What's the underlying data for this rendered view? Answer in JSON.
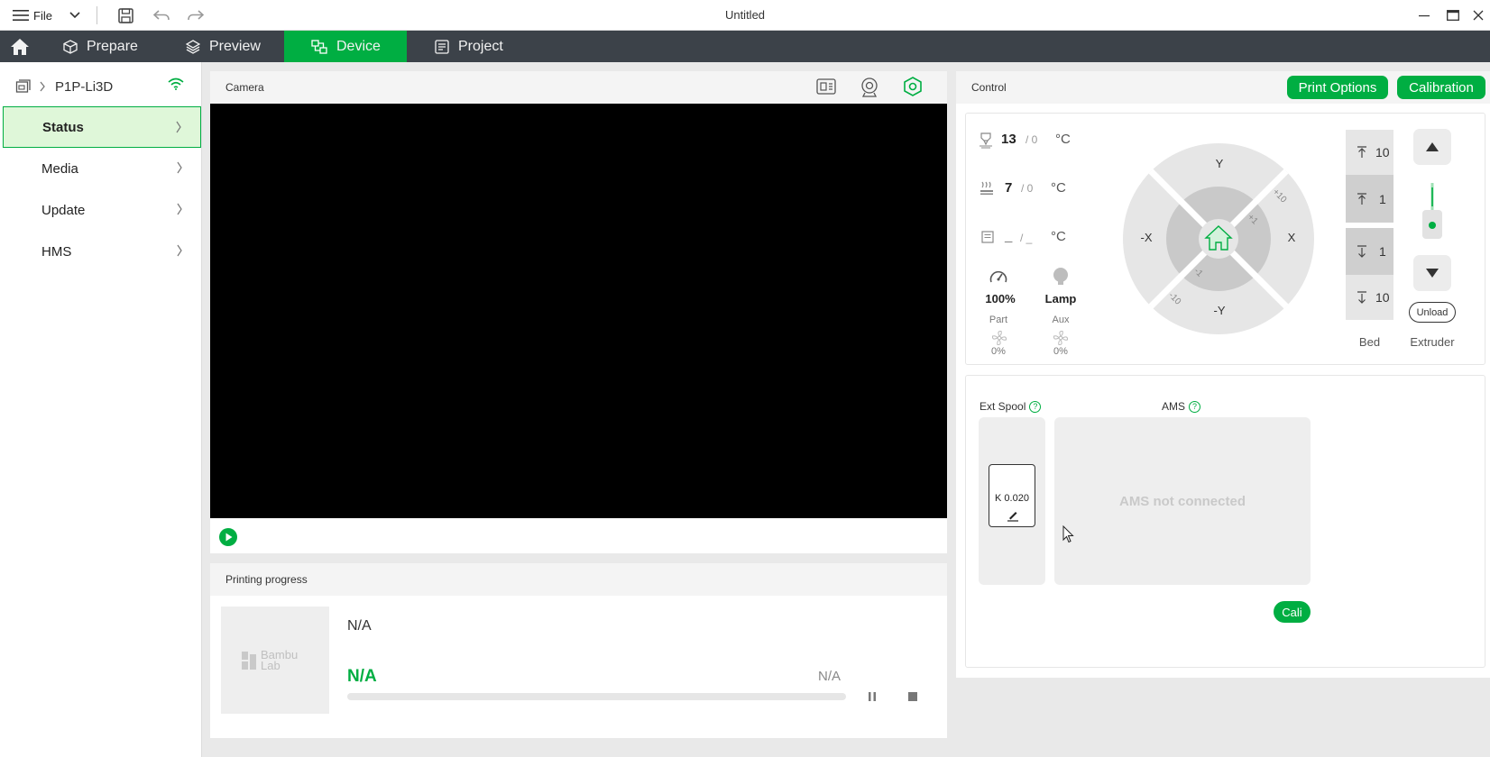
{
  "window": {
    "file_menu_label": "File",
    "title": "Untitled"
  },
  "nav": {
    "tabs": [
      {
        "label": "Prepare"
      },
      {
        "label": "Preview"
      },
      {
        "label": "Device",
        "active": true
      },
      {
        "label": "Project"
      }
    ]
  },
  "sidebar": {
    "printer_name": "P1P-Li3D",
    "items": [
      {
        "label": "Status",
        "active": true
      },
      {
        "label": "Media"
      },
      {
        "label": "Update"
      },
      {
        "label": "HMS"
      }
    ]
  },
  "camera": {
    "title": "Camera"
  },
  "progress": {
    "title": "Printing progress",
    "thumbnail_text": "Bambu Lab",
    "file_name": "N/A",
    "status": "N/A",
    "time": "N/A",
    "percent": 0
  },
  "control": {
    "title": "Control",
    "print_options_label": "Print Options",
    "calibration_label": "Calibration",
    "nozzle": {
      "current": "13",
      "target": "/ 0",
      "unit": "°C"
    },
    "bed": {
      "current": "7",
      "target": "/ 0",
      "unit": "°C"
    },
    "chamber": {
      "current": "_",
      "target": "/ _",
      "unit": "°C"
    },
    "speed": {
      "value": "100%"
    },
    "lamp": {
      "label": "Lamp"
    },
    "part_fan": {
      "label": "Part",
      "value": "0%"
    },
    "aux_fan": {
      "label": "Aux",
      "value": "0%"
    },
    "jog": {
      "y_plus": "Y",
      "y_minus": "-Y",
      "x_plus": "X",
      "x_minus": "-X",
      "step_plus_10": "+10",
      "step_plus_1": "+1",
      "step_minus_1": "-1",
      "step_minus_10": "-10"
    },
    "bed_moves": [
      {
        "label": "10",
        "dir": "up"
      },
      {
        "label": "1",
        "dir": "up"
      },
      {
        "label": "1",
        "dir": "down"
      },
      {
        "label": "10",
        "dir": "down"
      }
    ],
    "bed_label": "Bed",
    "extruder_label": "Extruder",
    "unload_label": "Unload"
  },
  "ams": {
    "ext_spool_label": "Ext Spool",
    "ams_label": "AMS",
    "help_glyph": "?",
    "k_value": "K 0.020",
    "not_connected": "AMS not connected",
    "cali_label": "Cali"
  },
  "colors": {
    "accent": "#00ae42",
    "nav_bg": "#3c4249",
    "sidebar_active_bg": "#dff7d9"
  }
}
